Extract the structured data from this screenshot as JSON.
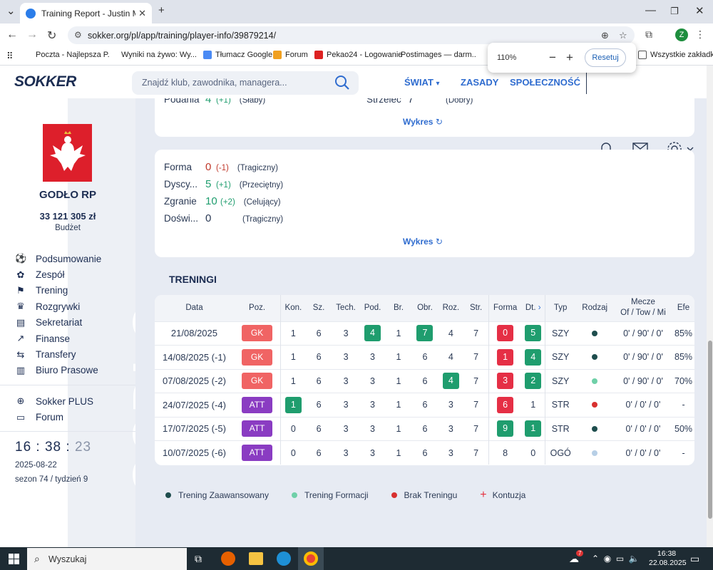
{
  "browser": {
    "tab_title": "Training Report - Justin Maesen",
    "url": "sokker.org/pl/app/training/player-info/39879214/",
    "profile_initial": "Z",
    "bookmarks": [
      "Poczta - Najlepsza P...",
      "Wyniki na żywo: Wy...",
      "Tłumacz Google",
      "Forum",
      "Pekao24 - Logowanie",
      "Postimages — darm...",
      "Wszystkie zakładki"
    ],
    "zoom": {
      "level": "110%",
      "reset_label": "Resetuj"
    }
  },
  "site": {
    "logo": "SOKKER",
    "search_placeholder": "Znajdź klub, zawodnika, managera...",
    "menu": {
      "world": "ŚWIAT",
      "rules": "ZASADY",
      "community": "SPOŁECZNOŚĆ"
    }
  },
  "sidebar": {
    "club_name": "GODŁO RP",
    "budget": "33 121 305 zł",
    "budget_label": "Budżet",
    "watermark": "GODŁO",
    "nav": [
      {
        "label": "Podsumowanie",
        "icon": "soccer-ball-icon"
      },
      {
        "label": "Zespół",
        "icon": "team-icon"
      },
      {
        "label": "Trening",
        "icon": "training-icon"
      },
      {
        "label": "Rozgrywki",
        "icon": "trophy-icon"
      },
      {
        "label": "Sekretariat",
        "icon": "office-icon"
      },
      {
        "label": "Finanse",
        "icon": "chart-icon"
      },
      {
        "label": "Transfery",
        "icon": "transfer-icon"
      },
      {
        "label": "Biuro Prasowe",
        "icon": "newspaper-icon"
      }
    ],
    "nav2": [
      {
        "label": "Sokker PLUS",
        "icon": "plus-circle-icon"
      },
      {
        "label": "Forum",
        "icon": "forum-icon"
      }
    ],
    "clock": {
      "h": "16",
      "m": "38",
      "s": "23"
    },
    "date": "2025-08-22",
    "season": "sezon 74 / tydzień 9"
  },
  "card1": {
    "skills": [
      {
        "name": "Podania",
        "value": "4",
        "delta": "(+1)",
        "desc": "(Słaby)"
      },
      {
        "name": "Strzelec",
        "value": "7",
        "delta": "",
        "desc": "(Dobry)"
      }
    ],
    "chart_link": "Wykres"
  },
  "card2": {
    "skills": [
      {
        "name": "Forma",
        "value": "0",
        "delta": "(-1)",
        "desc": "(Tragiczny)",
        "color": "#c0392b"
      },
      {
        "name": "Dyscy...",
        "value": "5",
        "delta": "(+1)",
        "desc": "(Przeciętny)",
        "color": "#1f9d6e"
      },
      {
        "name": "Zgranie",
        "value": "10",
        "delta": "(+2)",
        "desc": "(Celujący)",
        "color": "#1f9d6e"
      },
      {
        "name": "Doświ...",
        "value": "0",
        "delta": "",
        "desc": "(Tragiczny)",
        "color": "#2b3a55"
      }
    ],
    "chart_link": "Wykres"
  },
  "trainings": {
    "title": "TRENINGI",
    "columns": [
      "Data",
      "Poz.",
      "Kon.",
      "Sz.",
      "Tech.",
      "Pod.",
      "Br.",
      "Obr.",
      "Roz.",
      "Str.",
      "Forma",
      "Dt.",
      "Typ",
      "Rodzaj",
      "Mecze",
      "Of / Tow / Mi",
      "Efe"
    ],
    "rows": [
      {
        "date": "21/08/2025",
        "pos": "GK",
        "kon": "1",
        "sz": "6",
        "tech": "3",
        "pod": "4",
        "br": "1",
        "obr": "7",
        "roz": "4",
        "str": "7",
        "forma": "0",
        "dt": "5",
        "typ": "SZY",
        "rodzaj": "#1e4d4d",
        "mecze": "0' / 90' / 0'",
        "efe": "85%"
      },
      {
        "date": "14/08/2025 (-1)",
        "pos": "GK",
        "kon": "1",
        "sz": "6",
        "tech": "3",
        "pod": "3",
        "br": "1",
        "obr": "6",
        "roz": "4",
        "str": "7",
        "forma": "1",
        "dt": "4",
        "typ": "SZY",
        "rodzaj": "#1e4d4d",
        "mecze": "0' / 90' / 0'",
        "efe": "85%"
      },
      {
        "date": "07/08/2025 (-2)",
        "pos": "GK",
        "kon": "1",
        "sz": "6",
        "tech": "3",
        "pod": "3",
        "br": "1",
        "obr": "6",
        "roz": "4",
        "str": "7",
        "forma": "3",
        "dt": "2",
        "typ": "SZY",
        "rodzaj": "#6fd0a8",
        "mecze": "0' / 90' / 0'",
        "efe": "70%"
      },
      {
        "date": "24/07/2025 (-4)",
        "pos": "ATT",
        "kon": "1",
        "sz": "6",
        "tech": "3",
        "pod": "3",
        "br": "1",
        "obr": "6",
        "roz": "3",
        "str": "7",
        "forma": "6",
        "dt": "1",
        "typ": "STR",
        "rodzaj": "#d8302f",
        "mecze": "0' / 0' / 0'",
        "efe": "-"
      },
      {
        "date": "17/07/2025 (-5)",
        "pos": "ATT",
        "kon": "0",
        "sz": "6",
        "tech": "3",
        "pod": "3",
        "br": "1",
        "obr": "6",
        "roz": "3",
        "str": "7",
        "forma": "9",
        "dt": "1",
        "typ": "STR",
        "rodzaj": "#1e4d4d",
        "mecze": "0' / 0' / 0'",
        "efe": "50%"
      },
      {
        "date": "10/07/2025 (-6)",
        "pos": "ATT",
        "kon": "0",
        "sz": "6",
        "tech": "3",
        "pod": "3",
        "br": "1",
        "obr": "6",
        "roz": "3",
        "str": "7",
        "forma": "8",
        "dt": "0",
        "typ": "OGÓ",
        "rodzaj": "#b7cfe6",
        "mecze": "0' / 0' / 0'",
        "efe": "-"
      }
    ],
    "highlight": {
      "pod": [
        {
          "row": 0,
          "color": "#1f9d6e"
        }
      ],
      "obr": [
        {
          "row": 0,
          "color": "#1f9d6e"
        }
      ],
      "roz": [
        {
          "row": 2,
          "color": "#1f9d6e"
        }
      ],
      "kon": [
        {
          "row": 3,
          "color": "#1f9d6e"
        }
      ],
      "forma": [
        {
          "row": 0,
          "color": "#e52f45"
        },
        {
          "row": 1,
          "color": "#e52f45"
        },
        {
          "row": 2,
          "color": "#e52f45"
        },
        {
          "row": 3,
          "color": "#e52f45"
        },
        {
          "row": 4,
          "color": "#1f9d6e"
        }
      ],
      "dt": [
        {
          "row": 0,
          "color": "#1f9d6e"
        },
        {
          "row": 1,
          "color": "#1f9d6e"
        },
        {
          "row": 2,
          "color": "#1f9d6e"
        },
        {
          "row": 4,
          "color": "#1f9d6e"
        }
      ]
    },
    "pos_colors": {
      "GK": "#f06464",
      "ATT": "#8a3cc2"
    }
  },
  "legend": [
    {
      "label": "Trening Zaawansowany",
      "color": "#1e4d4d"
    },
    {
      "label": "Trening Formacji",
      "color": "#6fd0a8"
    },
    {
      "label": "Brak Treningu",
      "color": "#d8302f"
    },
    {
      "label": "Kontuzja",
      "color": "#e52f3d"
    }
  ],
  "taskbar": {
    "search_label": "Wyszukaj",
    "time": "16:38",
    "date": "22.08.2025",
    "weather_badge": "7"
  }
}
